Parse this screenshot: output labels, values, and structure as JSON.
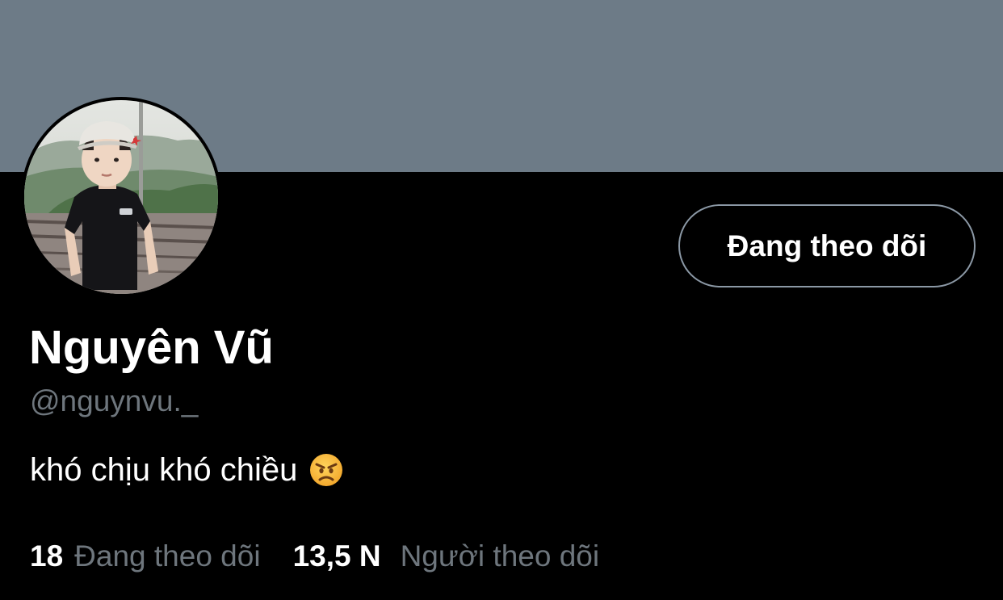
{
  "profile": {
    "display_name": "Nguyên Vũ",
    "handle": "@nguynvu._",
    "bio": "khó chịu khó chiều",
    "bio_emoji": "angry-face-emoji",
    "follow_button_label": "Đang theo dõi"
  },
  "stats": {
    "following_count": "18",
    "following_label": "Đang theo dõi",
    "followers_count": "13,5 N",
    "followers_label": "Người theo dõi"
  },
  "colors": {
    "banner": "#6d7b87",
    "background": "#000000",
    "primary_text": "#ffffff",
    "secondary_text": "#6e767d",
    "button_border": "#8b98a5"
  }
}
